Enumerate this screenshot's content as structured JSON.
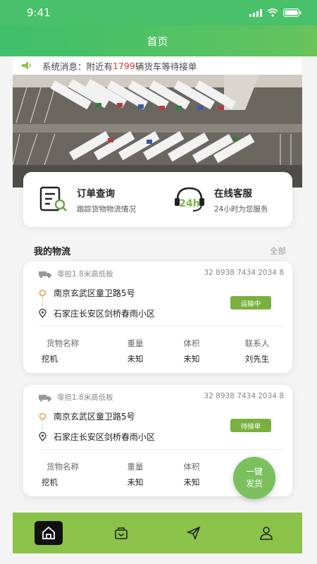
{
  "status": {
    "time": "9:41"
  },
  "header": {
    "title": "首页"
  },
  "notice": {
    "prefix": "系统消息：附近有",
    "count": "1799",
    "suffix": "辆货车等待接单"
  },
  "quick": [
    {
      "title": "订单查询",
      "sub": "跟踪货物物流情况"
    },
    {
      "title": "在线客服",
      "sub": "24小时为您服务",
      "icon_text": "24h"
    }
  ],
  "section": {
    "title": "我的物流",
    "more": "全部"
  },
  "shipments": [
    {
      "vehicle": "零担1.8米高低板",
      "number": "32 8938 7434 2034 8",
      "from": "南京玄武区童卫路5号",
      "to": "石家庄长安区剑桥春雨小区",
      "status": "运输中",
      "cols": [
        {
          "h": "货物名称",
          "v": "挖机"
        },
        {
          "h": "重量",
          "v": "未知"
        },
        {
          "h": "体积",
          "v": "未知"
        },
        {
          "h": "联系人",
          "v": "刘先生"
        }
      ]
    },
    {
      "vehicle": "零担1.8米高低板",
      "number": "32 8938 7434 2034 8",
      "from": "南京玄武区童卫路5号",
      "to": "石家庄长安区剑桥春雨小区",
      "status": "待接单",
      "cols": [
        {
          "h": "货物名称",
          "v": "挖机"
        },
        {
          "h": "重量",
          "v": "未知"
        },
        {
          "h": "体积",
          "v": "未知"
        }
      ]
    }
  ],
  "fab": {
    "line1": "一键",
    "line2": "发货"
  },
  "tabs": [
    {
      "icon": "home-icon",
      "active": true
    },
    {
      "icon": "package-icon"
    },
    {
      "icon": "send-icon"
    },
    {
      "icon": "user-icon"
    }
  ],
  "colors": {
    "brand_green": "#49c06a",
    "badge_green": "#78b13e",
    "tab_green": "#8bc34a",
    "alert_red": "#e2362b"
  }
}
